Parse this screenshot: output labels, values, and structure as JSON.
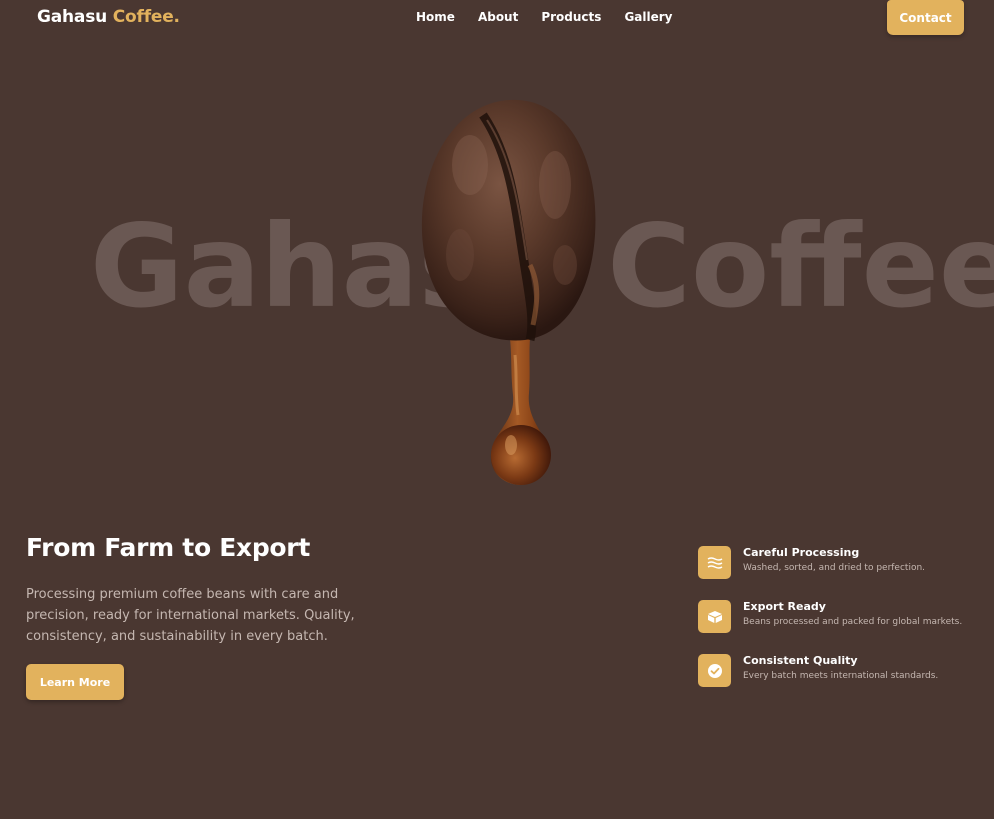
{
  "nav": {
    "logo_primary": "Gahasu",
    "logo_accent": "Coffee.",
    "links": [
      "Home",
      "About",
      "Products",
      "Gallery"
    ],
    "contact_label": "Contact"
  },
  "hero": {
    "background_word": "Gahasu Coffee",
    "image": "coffee-bean-with-drip"
  },
  "intro": {
    "headline": "From Farm to Export",
    "description": "Processing premium coffee beans with care and precision, ready for international markets. Quality, consistency, and sustainability in every batch.",
    "cta_label": "Learn More"
  },
  "features": [
    {
      "icon": "waves-icon",
      "title": "Careful Processing",
      "description": "Washed, sorted, and dried to perfection."
    },
    {
      "icon": "box-icon",
      "title": "Export Ready",
      "description": "Beans processed and packed for global markets."
    },
    {
      "icon": "check-circle-icon",
      "title": "Consistent Quality",
      "description": "Every batch meets international standards."
    }
  ],
  "colors": {
    "background": "#4a3731",
    "accent": "#e2b25d",
    "muted_text": "#c5b7b1",
    "hero_word": "#6a5853"
  }
}
